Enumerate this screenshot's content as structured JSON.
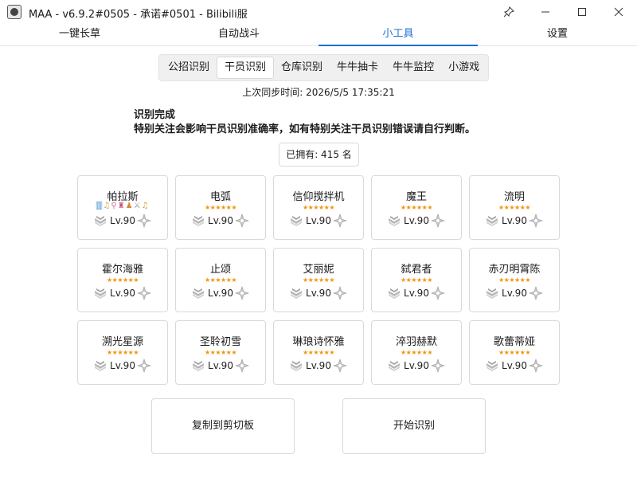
{
  "window": {
    "title": "MAA - v6.9.2#0505 - 承诺#0501 - Bilibili服",
    "pin_icon": "pin-icon",
    "minimize_icon": "minimize-icon",
    "maximize_icon": "maximize-icon",
    "close_icon": "close-icon"
  },
  "main_tabs": [
    {
      "label": "一键长草",
      "active": false
    },
    {
      "label": "自动战斗",
      "active": false
    },
    {
      "label": "小工具",
      "active": true
    },
    {
      "label": "设置",
      "active": false
    }
  ],
  "sub_tabs": [
    {
      "label": "公招识别",
      "active": false
    },
    {
      "label": "干员识别",
      "active": true
    },
    {
      "label": "仓库识别",
      "active": false
    },
    {
      "label": "牛牛抽卡",
      "active": false
    },
    {
      "label": "牛牛监控",
      "active": false
    },
    {
      "label": "小游戏",
      "active": false
    }
  ],
  "sync_time": "上次同步时间: 2026/5/5 17:35:21",
  "status": {
    "line1": "识别完成",
    "line2": "特别关注会影响干员识别准确率，如有特别关注干员识别错误请自行判断。"
  },
  "owned": "已拥有: 415 名",
  "operators": [
    {
      "name": "帕拉斯",
      "stars": "",
      "module_icons": [
        "🀫",
        "♫",
        "⚲",
        "♜",
        "♟",
        "⚔",
        "♫"
      ],
      "level": "Lv.90"
    },
    {
      "name": "电弧",
      "stars": "★★★★★★",
      "level": "Lv.90"
    },
    {
      "name": "信仰搅拌机",
      "stars": "★★★★★★",
      "level": "Lv.90"
    },
    {
      "name": "魔王",
      "stars": "★★★★★★",
      "level": "Lv.90"
    },
    {
      "name": "流明",
      "stars": "★★★★★★",
      "level": "Lv.90"
    },
    {
      "name": "霍尔海雅",
      "stars": "★★★★★★",
      "level": "Lv.90"
    },
    {
      "name": "止颂",
      "stars": "★★★★★★",
      "level": "Lv.90"
    },
    {
      "name": "艾丽妮",
      "stars": "★★★★★★",
      "level": "Lv.90"
    },
    {
      "name": "弑君者",
      "stars": "★★★★★★",
      "level": "Lv.90"
    },
    {
      "name": "赤刃明霄陈",
      "stars": "★★★★★★",
      "level": "Lv.90"
    },
    {
      "name": "溯光星源",
      "stars": "★★★★★★",
      "level": "Lv.90"
    },
    {
      "name": "圣聆初雪",
      "stars": "★★★★★★",
      "level": "Lv.90"
    },
    {
      "name": "琳琅诗怀雅",
      "stars": "★★★★★★",
      "level": "Lv.90"
    },
    {
      "name": "淬羽赫默",
      "stars": "★★★★★★",
      "level": "Lv.90"
    },
    {
      "name": "歌蕾蒂娅",
      "stars": "★★★★★★",
      "level": "Lv.90"
    }
  ],
  "buttons": {
    "copy": "复制到剪切板",
    "start": "开始识别"
  }
}
